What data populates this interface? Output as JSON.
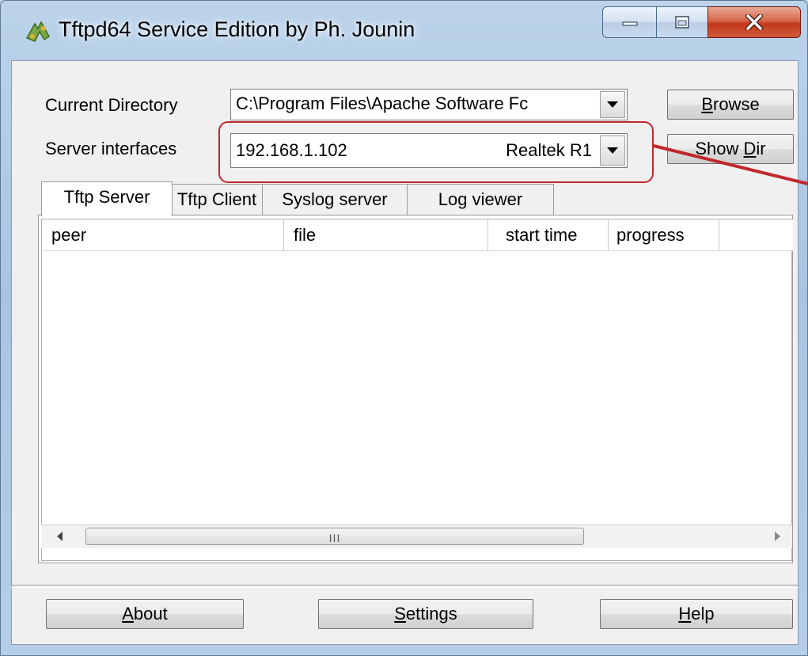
{
  "window": {
    "title": "Tftpd64 Service Edition by Ph. Jounin",
    "icon": "tftpd-app-icon",
    "controls": [
      "minimize-icon",
      "maximize-icon",
      "close-icon"
    ]
  },
  "settings": {
    "current_directory_label": "Current Directory",
    "current_directory_value": "C:\\Program Files\\Apache Software Fc",
    "server_interfaces_label": "Server interfaces",
    "server_interface_ip": "192.168.1.102",
    "server_interface_name": "Realtek R1",
    "browse_button": {
      "pre": "",
      "key": "B",
      "post": "rowse"
    },
    "showdir_button": {
      "pre": "Show ",
      "key": "D",
      "post": "ir"
    }
  },
  "tabs": [
    {
      "label": "Tftp Server",
      "active": true
    },
    {
      "label": "Tftp Client",
      "active": false
    },
    {
      "label": "Syslog server",
      "active": false
    },
    {
      "label": "Log viewer",
      "active": false
    }
  ],
  "table": {
    "columns": [
      "peer",
      "file",
      "start time",
      "progress",
      ""
    ],
    "rows": [],
    "scrollbar_grip": "III"
  },
  "footer": {
    "about": {
      "key": "A",
      "rest": "bout"
    },
    "settings": {
      "key": "S",
      "rest": "ettings"
    },
    "help": {
      "key": "H",
      "rest": "elp"
    }
  },
  "annotation": {
    "highlight_color": "#c0282d"
  },
  "colors": {
    "close_button": "#c2381c",
    "client_bg": "#f0f0f0",
    "title_bar": "#bcd3ea"
  }
}
